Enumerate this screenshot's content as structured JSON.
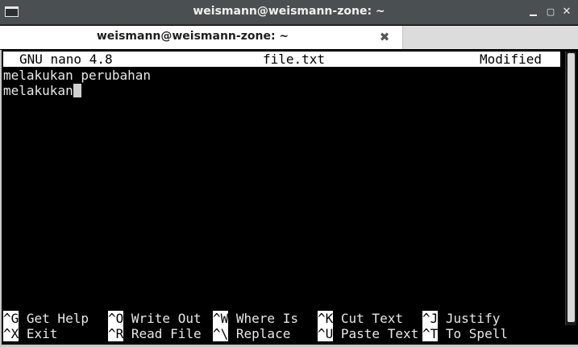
{
  "window": {
    "title": "weismann@weismann-zone: ~",
    "minimize_label": "",
    "maximize_label": "▢",
    "close_label": "✕"
  },
  "tab": {
    "label": "weismann@weismann-zone: ~",
    "close_label": "✖"
  },
  "nano": {
    "version": "GNU nano 4.8",
    "filename": "file.txt",
    "status": "Modified"
  },
  "buffer": {
    "lines": [
      "melakukan perubahan",
      "melakukan"
    ]
  },
  "shortcuts": {
    "row1": [
      {
        "key": "^G",
        "label": " Get Help"
      },
      {
        "key": "^O",
        "label": " Write Out"
      },
      {
        "key": "^W",
        "label": " Where Is"
      },
      {
        "key": "^K",
        "label": " Cut Text"
      },
      {
        "key": "^J",
        "label": " Justify"
      }
    ],
    "row2": [
      {
        "key": "^X",
        "label": " Exit"
      },
      {
        "key": "^R",
        "label": " Read File"
      },
      {
        "key": "^\\",
        "label": " Replace"
      },
      {
        "key": "^U",
        "label": " Paste Text"
      },
      {
        "key": "^T",
        "label": " To Spell"
      }
    ]
  }
}
